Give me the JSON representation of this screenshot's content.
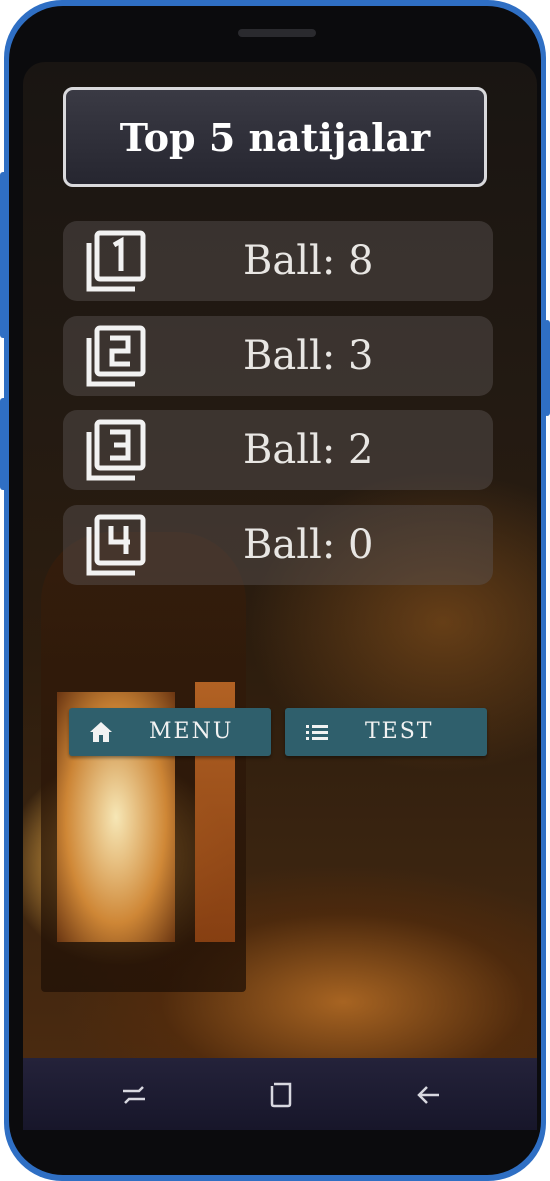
{
  "title": "Top 5 natijalar",
  "results": [
    {
      "rank_icon": "filter-1-icon",
      "score": "Ball: 8"
    },
    {
      "rank_icon": "filter-2-icon",
      "score": "Ball: 3"
    },
    {
      "rank_icon": "filter-3-icon",
      "score": "Ball: 2"
    },
    {
      "rank_icon": "filter-4-icon",
      "score": "Ball: 0"
    }
  ],
  "buttons": {
    "menu_label": "MENU",
    "menu_icon": "home-icon",
    "test_label": "TEST",
    "test_icon": "list-icon"
  },
  "navbar": {
    "icons": [
      "recent-apps-icon",
      "home-square-icon",
      "back-arrow-icon"
    ]
  },
  "colors": {
    "button_bg": "#2f5f6c",
    "frame_accent": "#2f6fc4"
  }
}
